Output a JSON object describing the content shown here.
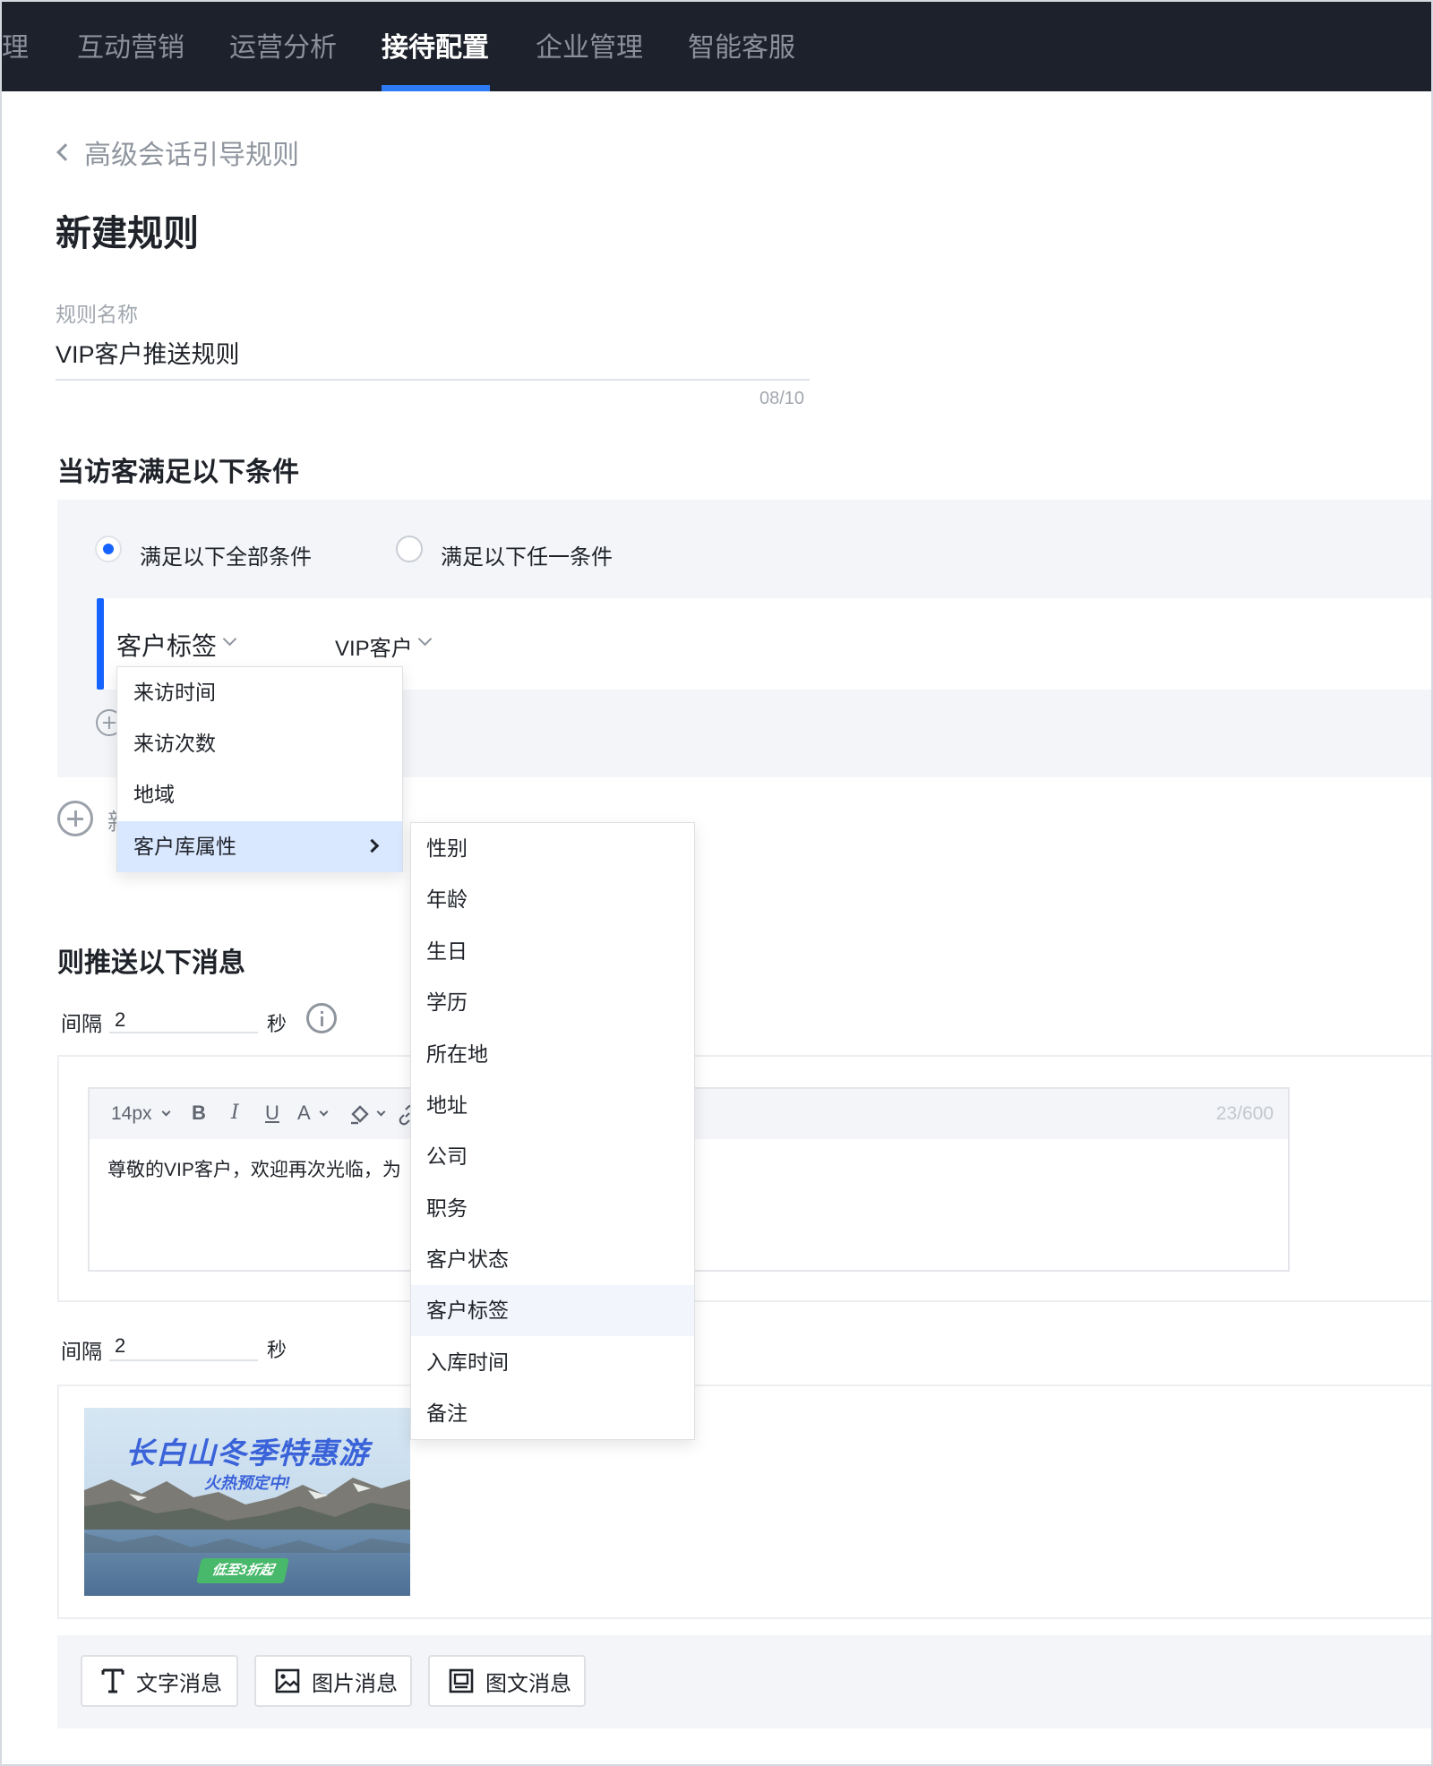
{
  "nav": {
    "items": [
      {
        "label": "理"
      },
      {
        "label": "互动营销"
      },
      {
        "label": "运营分析"
      },
      {
        "label": "接待配置",
        "active": true
      },
      {
        "label": "企业管理"
      },
      {
        "label": "智能客服"
      }
    ]
  },
  "header": {
    "back_label": "高级会话引导规则",
    "title": "新建规则"
  },
  "rule_name": {
    "label": "规则名称",
    "value": "VIP客户推送规则",
    "count": "08/10"
  },
  "conditions": {
    "title": "当访客满足以下条件",
    "match_all_label": "满足以下全部条件",
    "match_any_label": "满足以下任一条件",
    "selected_mode": "all",
    "rule": {
      "key": "客户标签",
      "value": "VIP客户"
    },
    "add_label": "新"
  },
  "condition_key_menu": {
    "items": [
      "来访时间",
      "来访次数",
      "地域",
      "客户库属性"
    ],
    "highlighted": "客户库属性"
  },
  "customer_attr_menu": {
    "items": [
      "性别",
      "年龄",
      "生日",
      "学历",
      "所在地",
      "地址",
      "公司",
      "职务",
      "客户状态",
      "客户标签",
      "入库时间",
      "备注"
    ],
    "hovered": "客户标签"
  },
  "push": {
    "title": "则推送以下消息",
    "interval_label": "间隔",
    "interval_unit": "秒",
    "interval1": "2",
    "interval2": "2",
    "editor": {
      "font_size": "14px",
      "bold": "B",
      "italic": "I",
      "underline": "U",
      "color": "A",
      "count": "23/600",
      "text": "尊敬的VIP客户，欢迎再次光临，为"
    },
    "banner": {
      "title": "长白山冬季特惠游",
      "subtitle": "火热预定中!",
      "tag": "低至3折起"
    }
  },
  "message_types": {
    "text": "文字消息",
    "image": "图片消息",
    "rich": "图文消息"
  },
  "colors": {
    "nav_bg": "#1d212b",
    "accent": "#1664ff",
    "highlight": "#d9e7ff"
  }
}
